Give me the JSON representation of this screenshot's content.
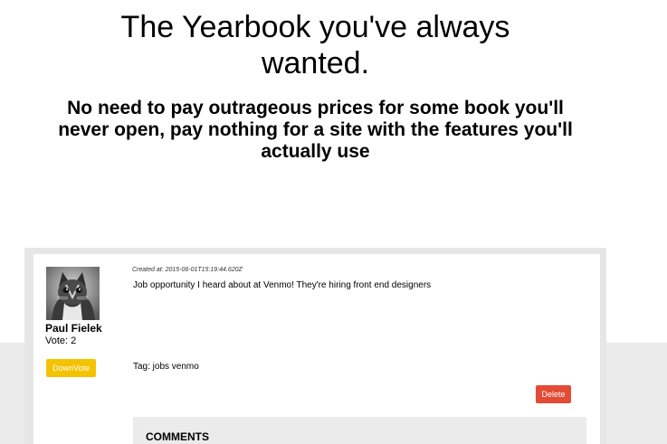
{
  "hero": {
    "title_line1": "The Yearbook you've always",
    "title_line2": "wanted.",
    "subtitle": "No need to pay outrageous prices for some book you'll never open, pay nothing for a site with the features you'll actually use"
  },
  "post": {
    "avatar_icon": "kitten-photo-icon",
    "author": "Paul Fielek",
    "vote_label": "Vote: 2",
    "downvote_label": "DownVote",
    "created_at": "Created at: 2015-06-01T15:19:44.620Z",
    "body": "Job opportunity I heard about at Venmo! They're hiring front end designers",
    "tag_line": "Tag: jobs venmo",
    "delete_label": "Delete",
    "comments_heading": "COMMENTS"
  },
  "colors": {
    "downvote": "#f3c200",
    "delete": "#e44b35",
    "panel": "#ebebeb"
  }
}
